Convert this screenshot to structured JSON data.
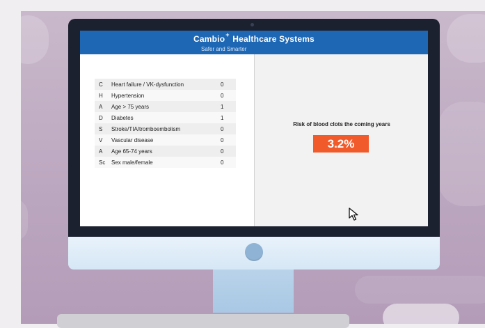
{
  "app": {
    "brand_name": "Cambio Healthcare Systems",
    "tagline": "Safer and Smarter"
  },
  "score_table": [
    {
      "abbr": "C",
      "label": "Heart failure / VK-dysfunction",
      "value": "0"
    },
    {
      "abbr": "H",
      "label": "Hypertension",
      "value": "0"
    },
    {
      "abbr": "A",
      "label": "Age > 75 years",
      "value": "1"
    },
    {
      "abbr": "D",
      "label": "Diabetes",
      "value": "1"
    },
    {
      "abbr": "S",
      "label": "Stroke/TIA/tromboembolism",
      "value": "0"
    },
    {
      "abbr": "V",
      "label": "Vascular disease",
      "value": "0"
    },
    {
      "abbr": "A",
      "label": "Age 65-74 years",
      "value": "0"
    },
    {
      "abbr": "Sc",
      "label": "Sex male/female",
      "value": "0"
    }
  ],
  "risk": {
    "title": "Risk of blood clots the coming years",
    "value": "3.2%"
  },
  "colors": {
    "header_blue": "#1e67b4",
    "risk_orange": "#f15a2b",
    "bezel_dark": "#1c2130"
  },
  "icons": {
    "cursor": "mouse-pointer-icon",
    "logo_mark": "plus-icon"
  }
}
